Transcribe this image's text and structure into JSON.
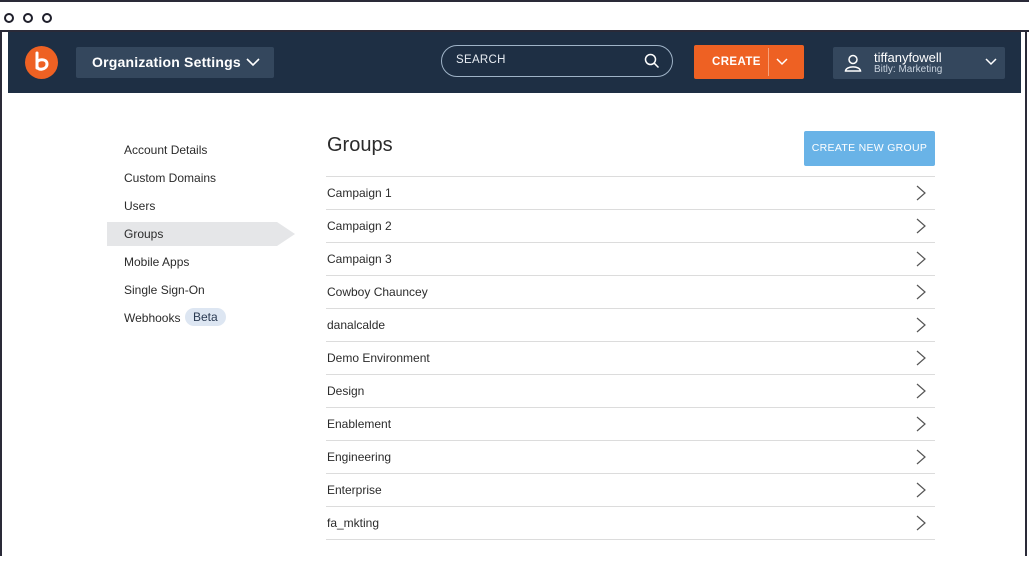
{
  "header": {
    "org_settings_label": "Organization Settings",
    "search_placeholder": "SEARCH",
    "create_label": "CREATE",
    "user": {
      "name": "tiffanyfowell",
      "org": "Bitly: Marketing"
    }
  },
  "sidebar": {
    "items": [
      {
        "label": "Account Details"
      },
      {
        "label": "Custom Domains"
      },
      {
        "label": "Users"
      },
      {
        "label": "Groups",
        "active": true
      },
      {
        "label": "Mobile Apps"
      },
      {
        "label": "Single Sign-On"
      },
      {
        "label": "Webhooks",
        "badge": "Beta"
      }
    ]
  },
  "main": {
    "title": "Groups",
    "create_group_label": "CREATE NEW GROUP",
    "groups": [
      "Campaign 1",
      "Campaign 2",
      "Campaign 3",
      "Cowboy Chauncey",
      "danalcalde",
      "Demo Environment",
      "Design",
      "Enablement",
      "Engineering",
      "Enterprise",
      "fa_mkting"
    ]
  },
  "colors": {
    "nav_bg": "#1e2f44",
    "accent_orange": "#ee6123",
    "button_blue": "#69b3e7"
  }
}
